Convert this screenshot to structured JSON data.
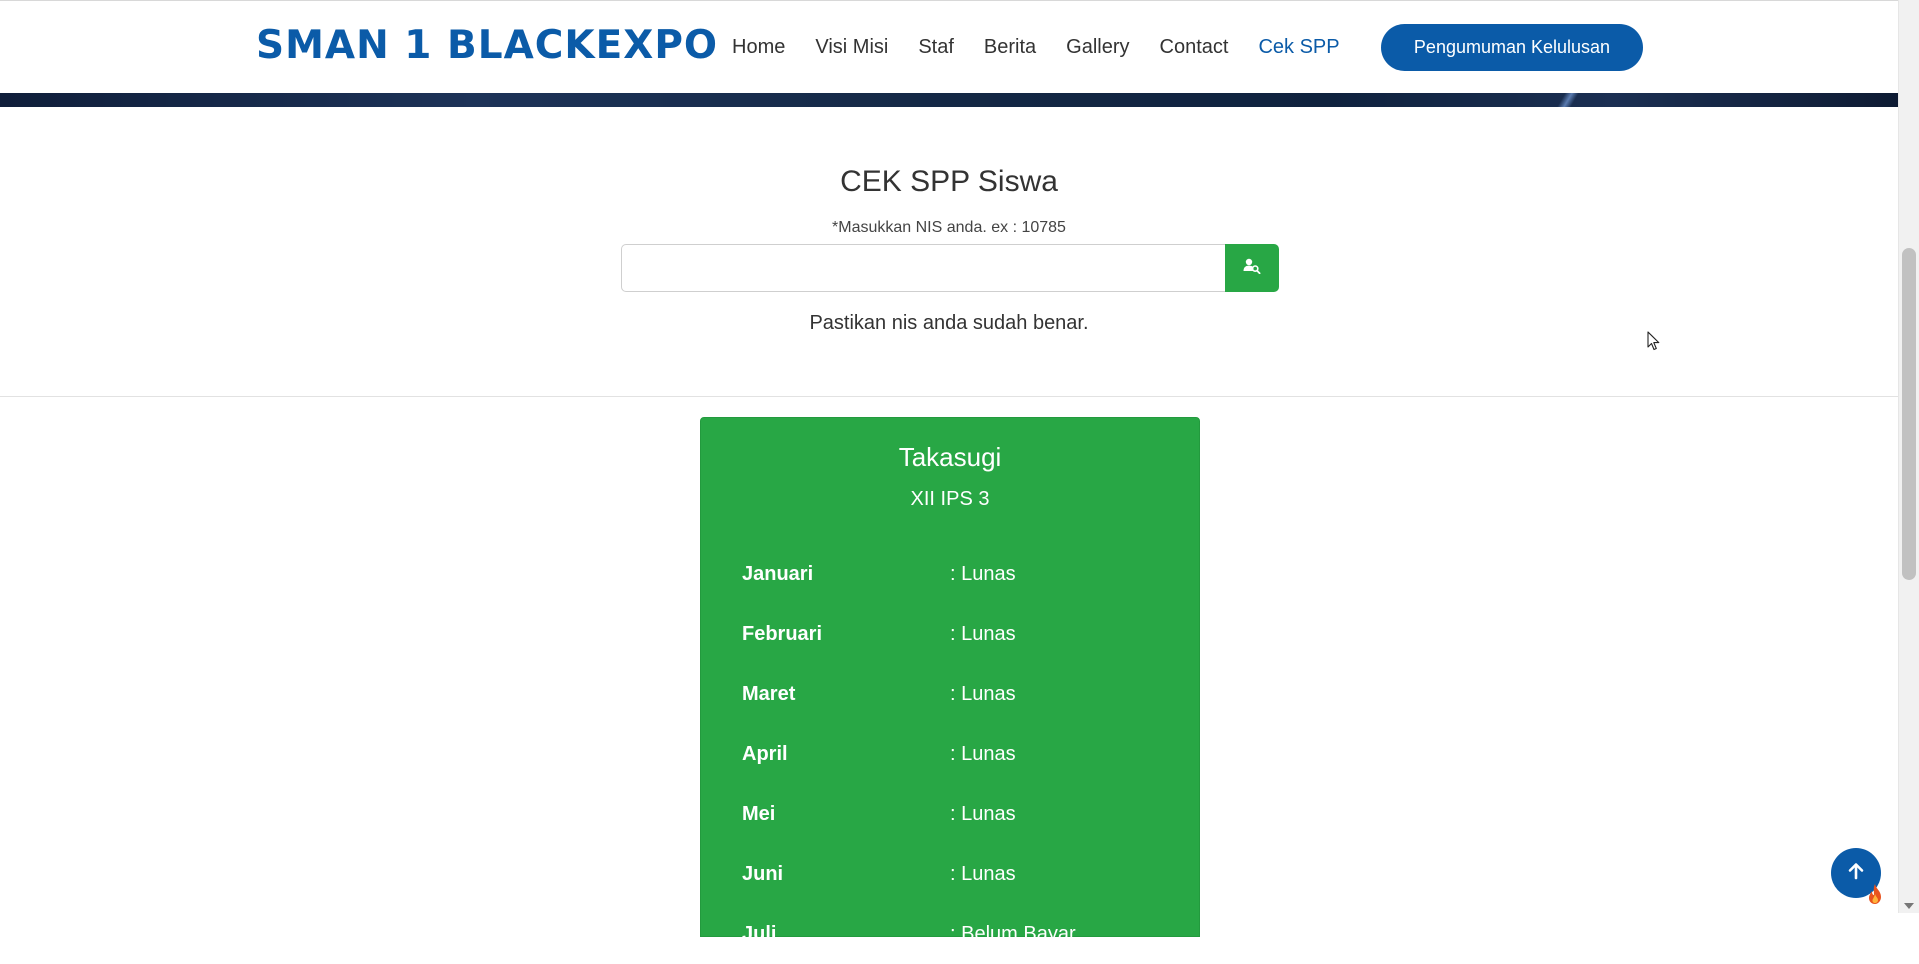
{
  "header": {
    "brand": "SMAN 1 BLACKEXPO",
    "nav": [
      "Home",
      "Visi Misi",
      "Staf",
      "Berita",
      "Gallery",
      "Contact",
      "Cek SPP"
    ],
    "active_nav": "Cek SPP",
    "cta": "Pengumuman Kelulusan"
  },
  "check": {
    "title": "CEK SPP Siswa",
    "hint": "*Masukkan NIS anda. ex : 10785",
    "input_value": "",
    "note": "Pastikan nis anda sudah benar."
  },
  "result": {
    "name": "Takasugi",
    "class": "XII IPS 3",
    "rows": [
      {
        "month": "Januari",
        "status": ": Lunas"
      },
      {
        "month": "Februari",
        "status": ": Lunas"
      },
      {
        "month": "Maret",
        "status": ": Lunas"
      },
      {
        "month": "April",
        "status": ": Lunas"
      },
      {
        "month": "Mei",
        "status": ": Lunas"
      },
      {
        "month": "Juni",
        "status": ": Lunas"
      },
      {
        "month": "Juli",
        "status": ": Belum Bayar"
      }
    ]
  },
  "colors": {
    "brand_blue": "#0b5ba8",
    "success_green": "#28a745"
  },
  "icons": {
    "search": "user-search-icon",
    "to_top": "arrow-up-icon",
    "corner": "flame-icon"
  }
}
